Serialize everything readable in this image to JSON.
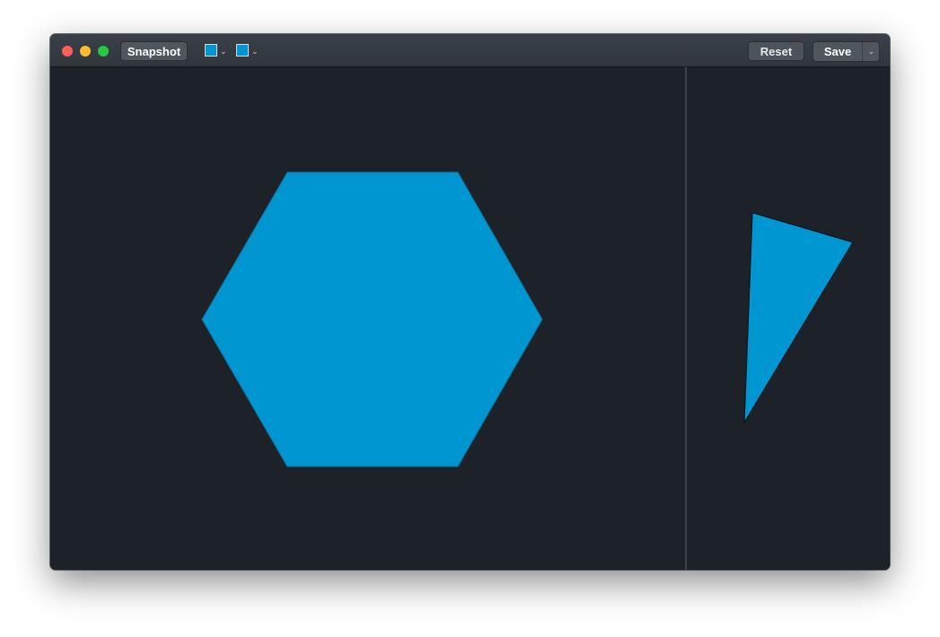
{
  "toolbar": {
    "snapshot_label": "Snapshot",
    "reset_label": "Reset",
    "save_label": "Save"
  },
  "fill_color": "#0096d1",
  "stroke_color": "#0096d1",
  "shapes": {
    "hexagon": {
      "type": "hexagon",
      "fill": "#0096d1"
    },
    "triangle": {
      "type": "triangle",
      "fill": "#0096d1"
    }
  },
  "colors": {
    "canvas_background": "#1d2229",
    "titlebar": "#363b42",
    "divider": "#3a4047"
  },
  "icons": {
    "fill_picker": "color-swatch-icon",
    "stroke_picker": "color-swatch-icon",
    "dropdown": "chevron-down-icon"
  }
}
